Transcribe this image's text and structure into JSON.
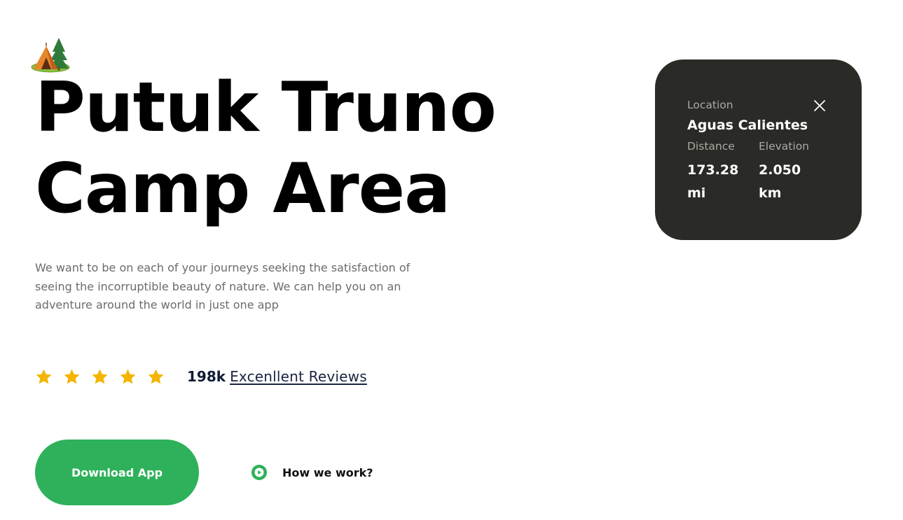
{
  "hero": {
    "logo_icon": "camping-tent-emoji-icon",
    "title_line1": "Putuk Truno",
    "title_line2": "Camp Area",
    "description": "We want to be on each of your journeys seeking the satisfaction of seeing the incorruptible beauty of nature. We can help you on an adventure around the world in just one app"
  },
  "rating": {
    "stars": 5,
    "star_icon": "star-icon",
    "star_color": "#f4b400",
    "count": "198k",
    "link_text": "Excenllent Reviews"
  },
  "actions": {
    "download_label": "Download App",
    "how_label": "How we work?",
    "how_icon": "play-icon"
  },
  "location_card": {
    "location_label": "Location",
    "location_value": "Aguas Calientes",
    "distance_label": "Distance",
    "distance_value_line1": "173.28",
    "distance_value_line2": "mi",
    "elevation_label": "Elevation",
    "elevation_value_line1": "2.050",
    "elevation_value_line2": "km",
    "close_icon": "close-icon"
  },
  "colors": {
    "accent_green": "#2eb15a",
    "card_background": "#2a2b27",
    "muted_text": "#6b6b6b",
    "card_label": "#a9aaa5",
    "review_text": "#0f1b33"
  }
}
